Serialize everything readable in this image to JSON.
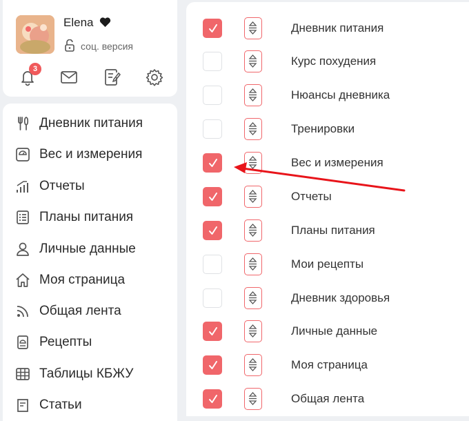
{
  "profile": {
    "name": "Elena",
    "version_label": "соц. версия",
    "notifications_count": "3"
  },
  "menu": {
    "items": [
      {
        "label": "Дневник питания",
        "icon": "fork-knife-icon"
      },
      {
        "label": "Вес и измерения",
        "icon": "scale-icon"
      },
      {
        "label": "Отчеты",
        "icon": "bar-chart-icon"
      },
      {
        "label": "Планы питания",
        "icon": "list-icon"
      },
      {
        "label": "Личные данные",
        "icon": "user-icon"
      },
      {
        "label": "Моя страница",
        "icon": "home-icon"
      },
      {
        "label": "Общая лента",
        "icon": "rss-icon"
      },
      {
        "label": "Рецепты",
        "icon": "recipe-icon"
      },
      {
        "label": "Таблицы КБЖУ",
        "icon": "table-icon"
      },
      {
        "label": "Статьи",
        "icon": "article-icon"
      }
    ]
  },
  "settings": {
    "rows": [
      {
        "label": "Дневник питания",
        "checked": true
      },
      {
        "label": "Курс похудения",
        "checked": false
      },
      {
        "label": "Нюансы дневника",
        "checked": false
      },
      {
        "label": "Тренировки",
        "checked": false
      },
      {
        "label": "Вес и измерения",
        "checked": true
      },
      {
        "label": "Отчеты",
        "checked": true
      },
      {
        "label": "Планы питания",
        "checked": true
      },
      {
        "label": "Мои рецепты",
        "checked": false
      },
      {
        "label": "Дневник здоровья",
        "checked": false
      },
      {
        "label": "Личные данные",
        "checked": true
      },
      {
        "label": "Моя страница",
        "checked": true
      },
      {
        "label": "Общая лента",
        "checked": true
      }
    ]
  },
  "colors": {
    "accent": "#f0666a",
    "annotation_arrow": "#e8141a"
  }
}
